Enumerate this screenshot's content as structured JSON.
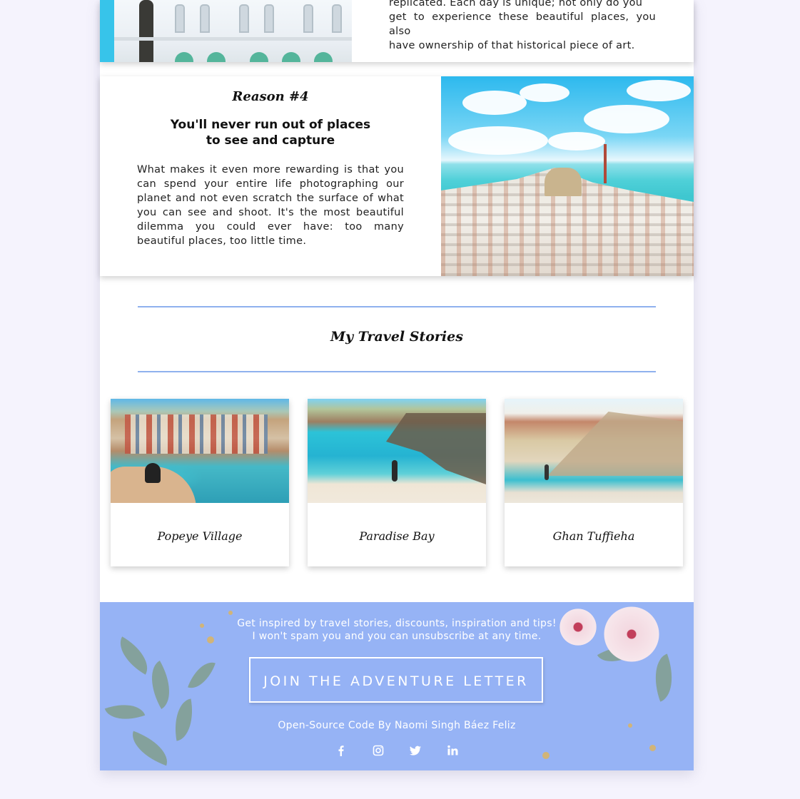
{
  "intro": {
    "lines": [
      "replicated. Each day is unique; not only do you",
      "get to experience these beautiful places, you also",
      "have ownership of that historical piece of art."
    ]
  },
  "reason": {
    "title": "Reason #4",
    "subtitle": "You'll never run out of places to see and capture",
    "body": "What makes it even more rewarding is that you can spend your entire life photographing our planet and not even scratch the surface of what you can see and shoot. It's the most beautiful dilemma you could ever have: too many beautiful places, too little time."
  },
  "stories": {
    "title": "My Travel Stories",
    "items": [
      {
        "label": "Popeye Village"
      },
      {
        "label": "Paradise Bay"
      },
      {
        "label": "Ghan Tuffieha"
      }
    ]
  },
  "footer": {
    "line1": "Get inspired by travel stories, discounts, inspiration and tips!",
    "line2": "I won't spam you and you can unsubscribe at any time.",
    "button_label": "JOIN THE ADVENTURE LETTER",
    "credit": "Open-Source Code By Naomi Singh Báez Feliz",
    "social": [
      "facebook-icon",
      "instagram-icon",
      "twitter-icon",
      "linkedin-icon"
    ]
  },
  "colors": {
    "accent": "#8fb1ee",
    "footer_bg": "#96b3f5",
    "page_bg": "#f5f3fd"
  }
}
